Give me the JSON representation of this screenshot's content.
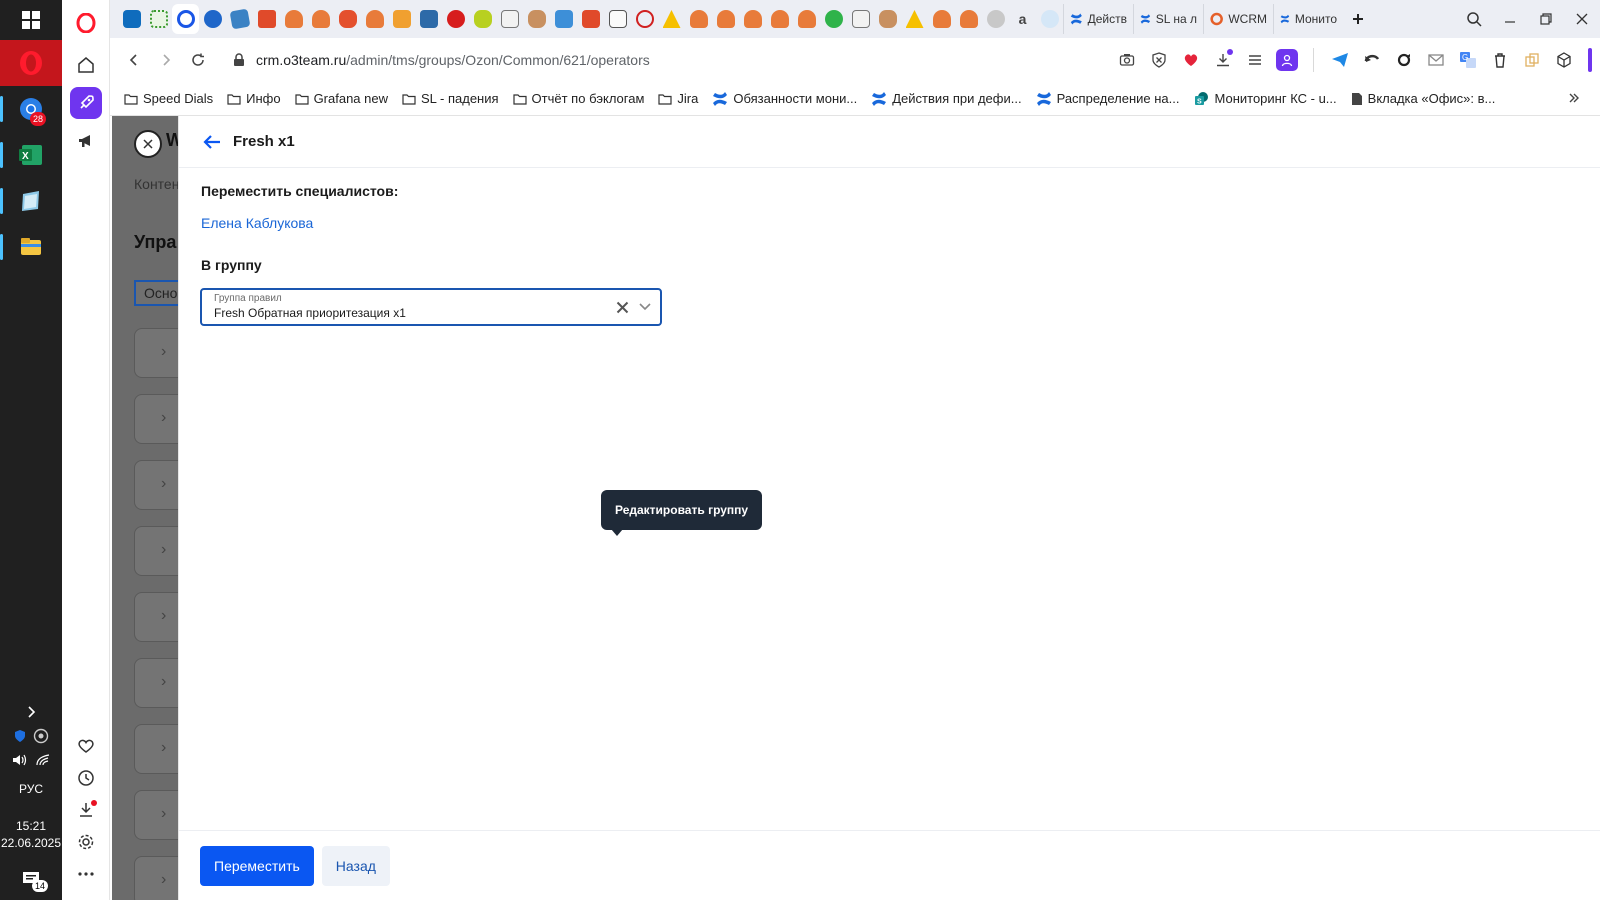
{
  "taskbar": {
    "apps": [
      {
        "name": "opera",
        "color": "#ff1b2d"
      },
      {
        "name": "chrome",
        "badge": "28"
      },
      {
        "name": "excel"
      },
      {
        "name": "notes"
      },
      {
        "name": "explorer"
      }
    ],
    "lang": "РУС",
    "time": "15:21",
    "date": "22.06.2025",
    "notifications": "14"
  },
  "tabs": {
    "full": [
      {
        "label": "Действ",
        "icon": "confluence-icon"
      },
      {
        "label": "SL на л",
        "icon": "confluence-icon"
      },
      {
        "label": "WCRM",
        "icon": "wcrm-icon"
      },
      {
        "label": "Монито",
        "icon": "confluence-icon"
      }
    ]
  },
  "address": {
    "host": "crm.o3team.ru",
    "path": "/admin/tms/groups/Ozon/Common/621/operators"
  },
  "bookmarks": [
    {
      "label": "Speed Dials",
      "icon": "folder-icon"
    },
    {
      "label": "Инфо",
      "icon": "folder-icon"
    },
    {
      "label": "Grafana new",
      "icon": "folder-icon"
    },
    {
      "label": "SL - падения",
      "icon": "folder-icon"
    },
    {
      "label": "Отчёт по бэклогам",
      "icon": "folder-icon"
    },
    {
      "label": "Jira",
      "icon": "folder-icon"
    },
    {
      "label": "Обязанности мони...",
      "icon": "confluence-icon"
    },
    {
      "label": "Действия при дефи...",
      "icon": "confluence-icon"
    },
    {
      "label": "Распределение на...",
      "icon": "confluence-icon"
    },
    {
      "label": "Мониторинг КС - u...",
      "icon": "sharepoint-icon"
    },
    {
      "label": "Вкладка «Офис»: в...",
      "icon": "document-icon"
    }
  ],
  "background": {
    "letter": "W",
    "text1": "Контен",
    "heading": "Упра",
    "button": "Осно"
  },
  "panel": {
    "title": "Fresh x1",
    "move_label": "Переместить специалистов:",
    "specialist": "Елена Каблукова",
    "group_label": "В группу",
    "select": {
      "label": "Группа правил",
      "value": "Fresh Обратная приоритезация x1"
    },
    "tooltip": "Редактировать группу",
    "move_button": "Переместить",
    "back_button": "Назад"
  },
  "colors": {
    "primary": "#0a57f2",
    "link": "#1a66d6",
    "accent": "#6f35ef",
    "tooltip_bg": "#1f2a38"
  }
}
